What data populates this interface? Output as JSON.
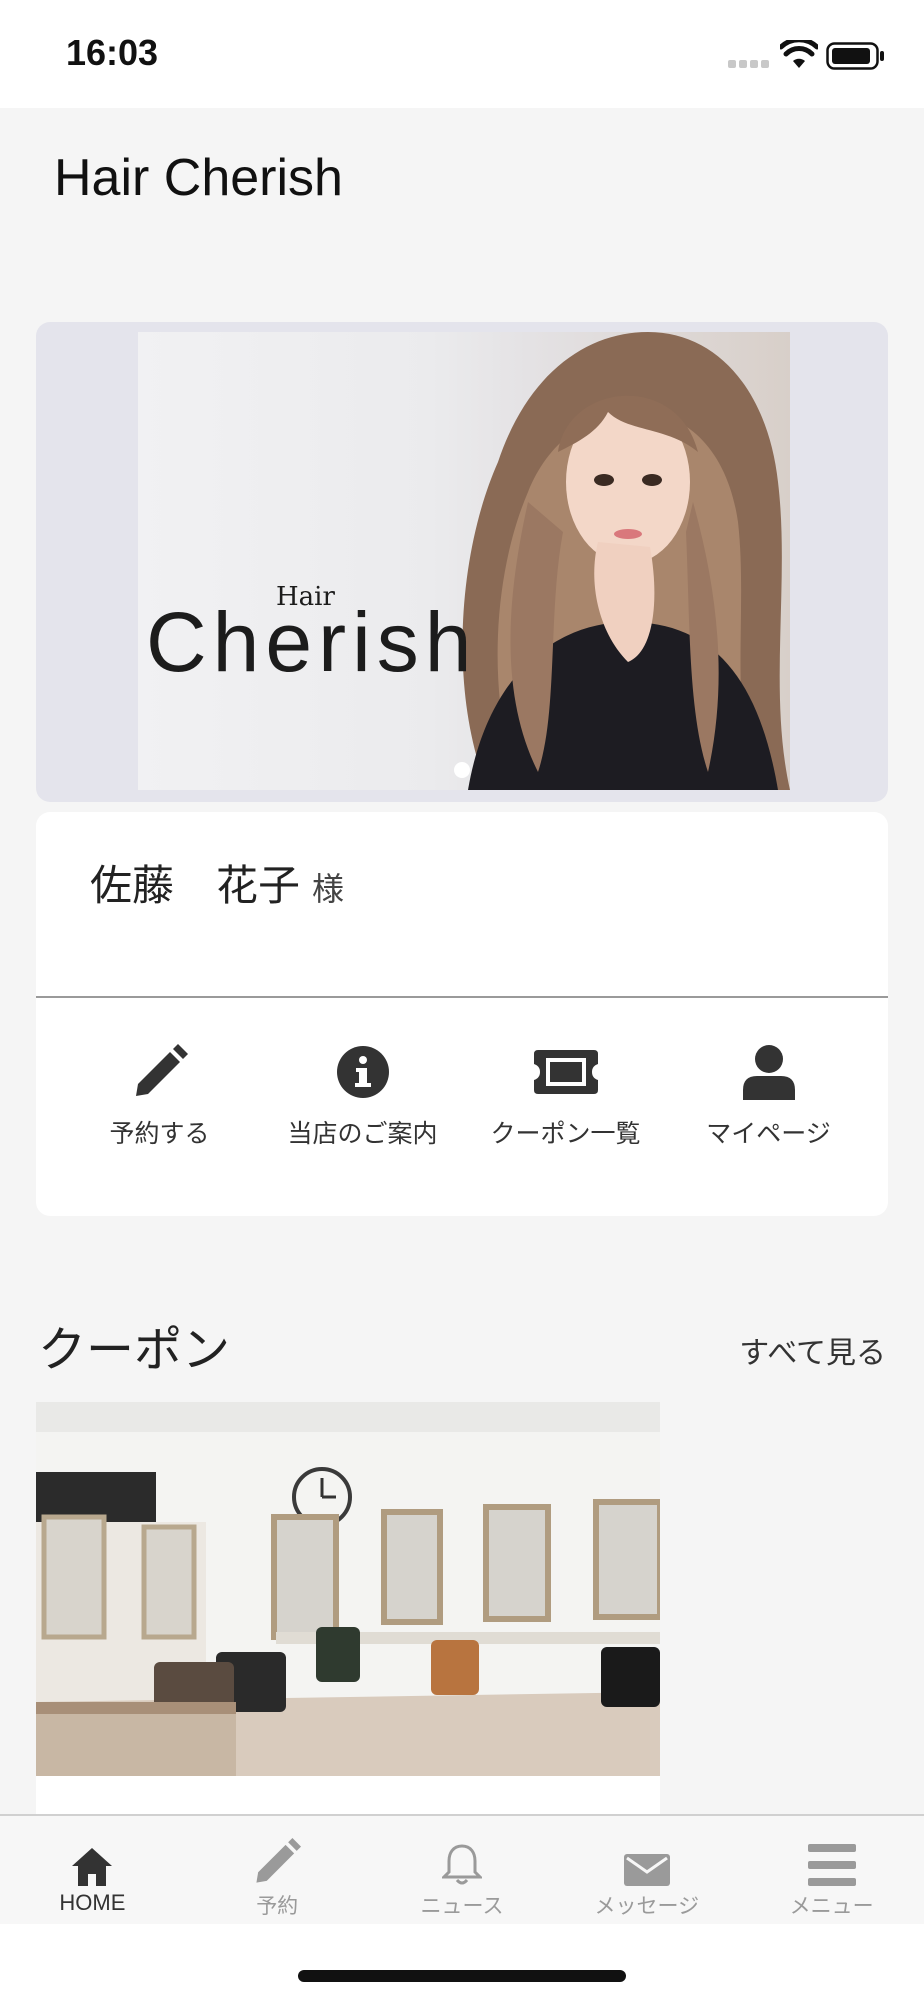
{
  "status_bar": {
    "time": "16:03"
  },
  "app": {
    "title": "Hair Cherish"
  },
  "banner": {
    "logo_small": "Hair",
    "logo_big": "Cherish",
    "slide_count": 1,
    "active_slide": 1
  },
  "user": {
    "name": "佐藤　花子",
    "suffix": "様"
  },
  "quick_actions": [
    {
      "label": "予約する",
      "icon": "pencil-icon"
    },
    {
      "label": "当店のご案内",
      "icon": "info-icon"
    },
    {
      "label": "クーポン一覧",
      "icon": "ticket-icon"
    },
    {
      "label": "マイページ",
      "icon": "person-icon"
    }
  ],
  "coupon_section": {
    "title": "クーポン",
    "see_all": "すべて見る"
  },
  "bottom_nav": [
    {
      "label": "HOME",
      "icon": "home-icon",
      "active": true
    },
    {
      "label": "予約",
      "icon": "pencil-icon",
      "active": false
    },
    {
      "label": "ニュース",
      "icon": "bell-icon",
      "active": false
    },
    {
      "label": "メッセージ",
      "icon": "envelope-icon",
      "active": false
    },
    {
      "label": "メニュー",
      "icon": "hamburger-icon",
      "active": false
    }
  ],
  "colors": {
    "background": "#f5f5f5",
    "card": "#ffffff",
    "banner_bg": "#e4e4ec",
    "icon_dark": "#333333",
    "nav_inactive": "#9a9a9a"
  }
}
